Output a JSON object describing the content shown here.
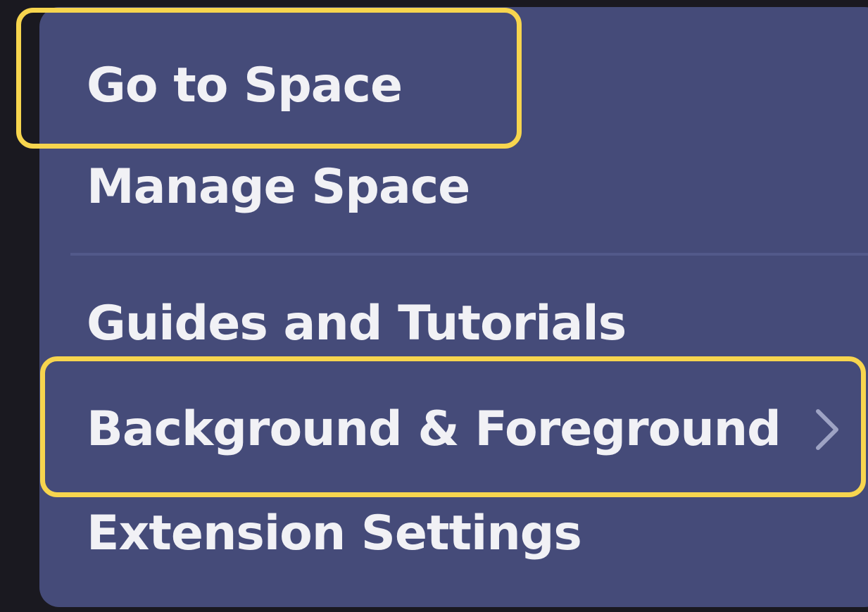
{
  "menu": {
    "items": [
      {
        "label": "Go to Space",
        "highlighted": true
      },
      {
        "label": "Manage Space"
      },
      {
        "label": "Guides and Tutorials"
      },
      {
        "label": "Background & Foreground",
        "has_submenu": true,
        "submenu_icon": "chevron-right-icon",
        "highlighted": true
      },
      {
        "label": "Extension Settings"
      }
    ]
  },
  "colors": {
    "menu_background": "#454b79",
    "page_background": "#1a1920",
    "highlight": "#f7d54e",
    "text": "#f1f1f5",
    "divider": "#52598a"
  }
}
